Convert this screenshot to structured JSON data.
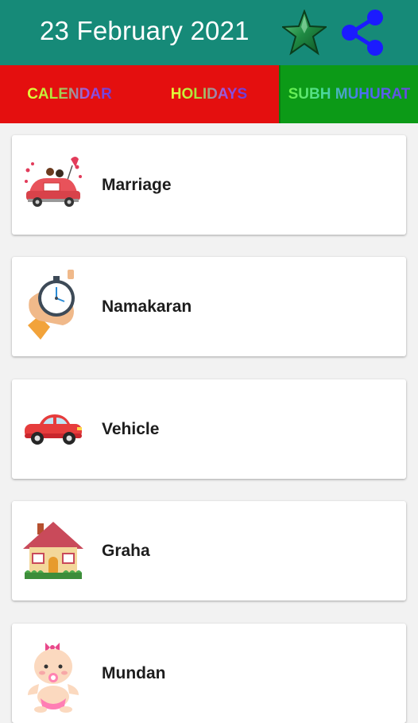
{
  "header": {
    "title": "23 February 2021"
  },
  "tabs": [
    {
      "label": "CALENDAR"
    },
    {
      "label": "HOLIDAYS"
    },
    {
      "label": "SUBH MUHURAT"
    }
  ],
  "muhurat_items": [
    {
      "label": "Marriage",
      "icon": "wedding-car-icon"
    },
    {
      "label": "Namakaran",
      "icon": "stopwatch-hand-icon"
    },
    {
      "label": "Vehicle",
      "icon": "car-icon"
    },
    {
      "label": "Graha",
      "icon": "house-icon"
    },
    {
      "label": "Mundan",
      "icon": "baby-icon"
    }
  ],
  "colors": {
    "header_bg": "#168a78",
    "tab_inactive_bg": "#e40f0f",
    "tab_active_bg": "#0c9a17"
  }
}
